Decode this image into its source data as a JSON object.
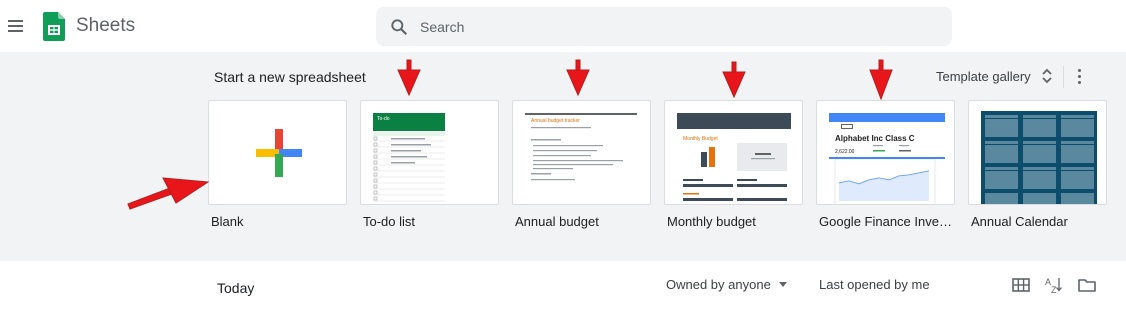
{
  "header": {
    "app_title": "Sheets",
    "search_placeholder": "Search"
  },
  "templates_section": {
    "title": "Start a new spreadsheet",
    "gallery_label": "Template gallery",
    "templates": [
      {
        "label": "Blank"
      },
      {
        "label": "To-do list"
      },
      {
        "label": "Annual budget"
      },
      {
        "label": "Monthly budget"
      },
      {
        "label": "Google Finance Investment Tracker"
      },
      {
        "label": "Annual Calendar"
      }
    ]
  },
  "thumbnails": {
    "todo_header": "To-do",
    "budget_title": "Annual budget tracker",
    "monthly_title": "Monthly Budget",
    "finance_title": "Alphabet Inc Class C",
    "finance_price": "2,622.00"
  },
  "recent": {
    "today_label": "Today",
    "owner_filter": "Owned by anyone",
    "sort_label": "Last opened by me"
  },
  "colors": {
    "band_bg": "#f1f3f4",
    "sheets_green": "#0f9d58",
    "annotation_red": "#e8161b"
  }
}
